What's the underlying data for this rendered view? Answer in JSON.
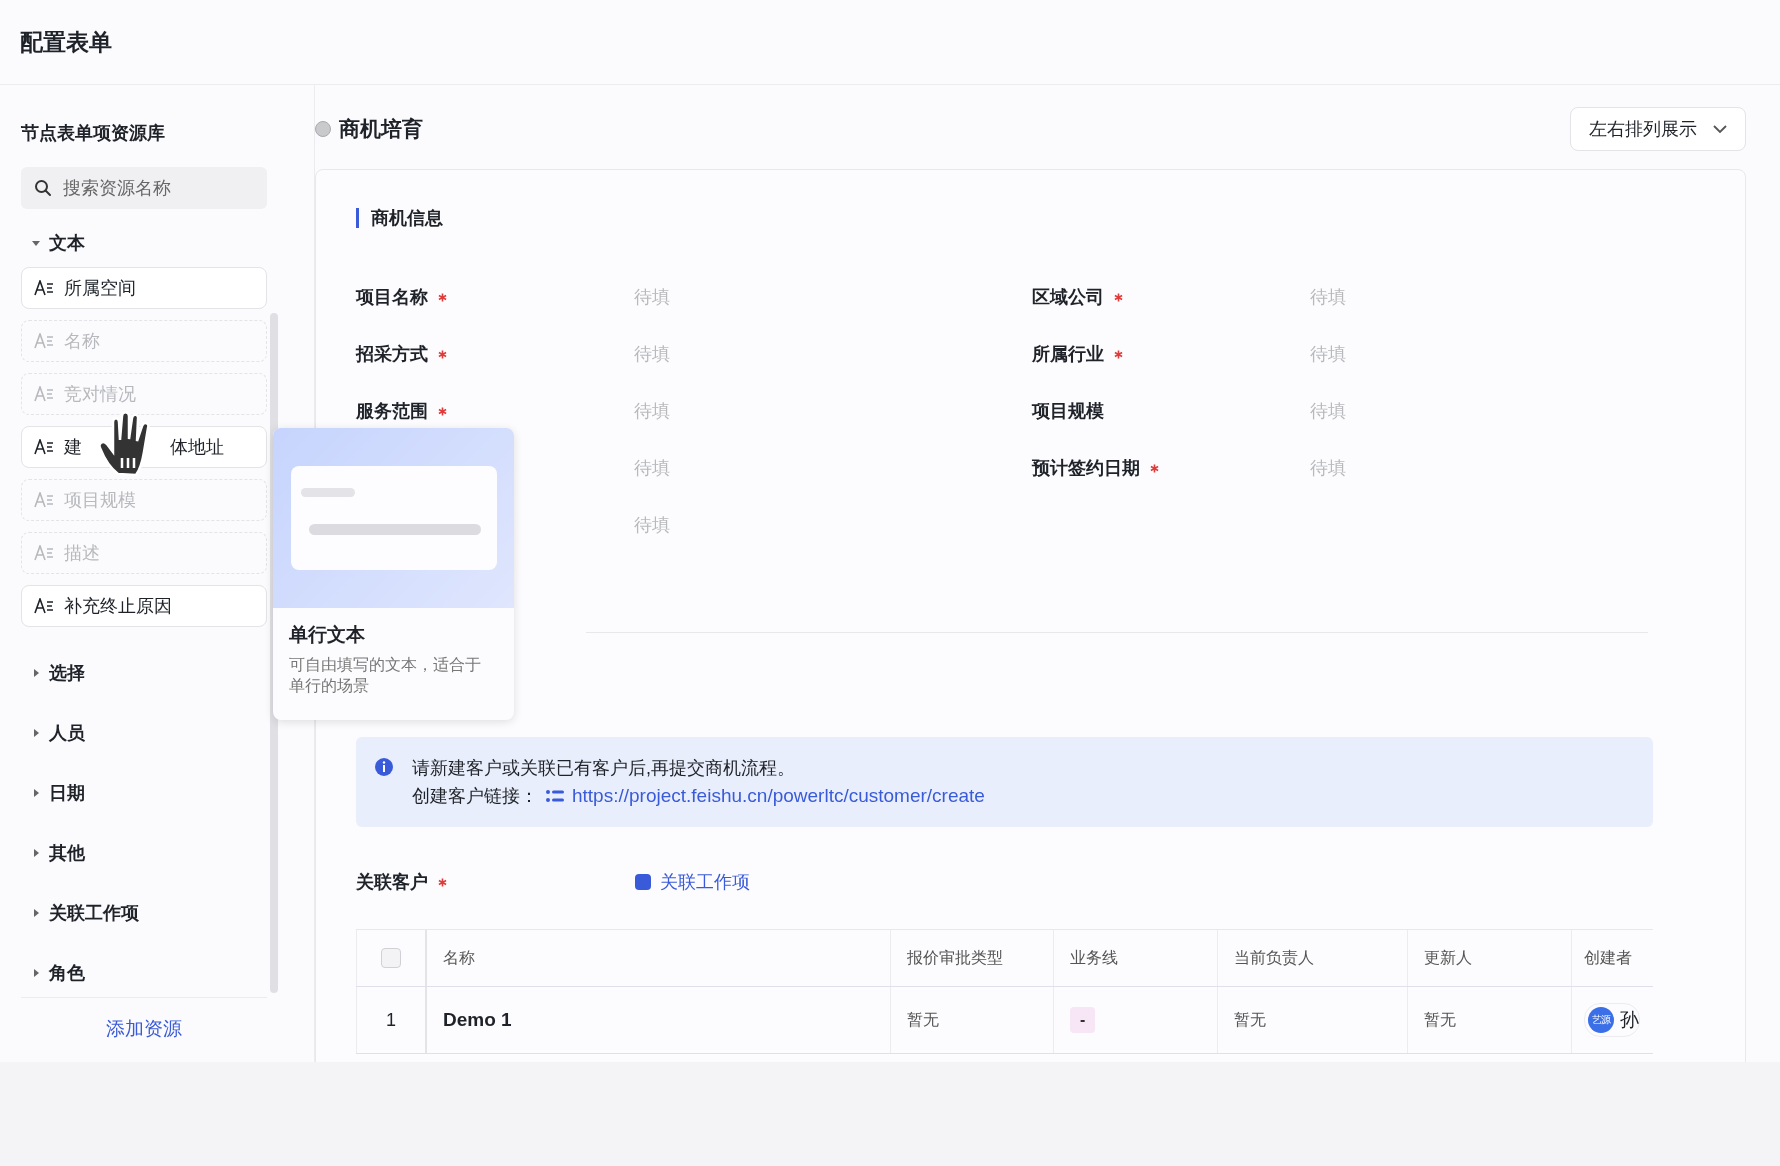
{
  "page_title": "配置表单",
  "sidebar": {
    "title": "节点表单项资源库",
    "search": {
      "placeholder": "搜索资源名称"
    },
    "groups": [
      {
        "label": "文本",
        "expanded": true,
        "items": [
          {
            "label_parts": [
              "所属空间"
            ],
            "disabled": false
          },
          {
            "label_parts": [
              "名称"
            ],
            "disabled": true
          },
          {
            "label_parts": [
              "竞对情况"
            ],
            "disabled": true
          },
          {
            "label_parts": [
              "建",
              "体地址"
            ],
            "disabled": false
          },
          {
            "label_parts": [
              "项目规模"
            ],
            "disabled": true
          },
          {
            "label_parts": [
              "描述"
            ],
            "disabled": true
          },
          {
            "label_parts": [
              "补充终止原因"
            ],
            "disabled": false
          }
        ]
      },
      {
        "label": "选择",
        "expanded": false
      },
      {
        "label": "人员",
        "expanded": false
      },
      {
        "label": "日期",
        "expanded": false
      },
      {
        "label": "其他",
        "expanded": false
      },
      {
        "label": "关联工作项",
        "expanded": false
      },
      {
        "label": "角色",
        "expanded": false
      }
    ],
    "add_button": "添加资源"
  },
  "tooltip": {
    "title": "单行文本",
    "description": "可自由填写的文本，适合于单行的场景"
  },
  "stage": {
    "title": "商机培育",
    "layout_select": "左右排列展示"
  },
  "section": {
    "title": "商机信息",
    "fields": [
      {
        "label": "项目名称",
        "required": true,
        "value": "待填"
      },
      {
        "label": "区域公司",
        "required": true,
        "value": "待填"
      },
      {
        "label": "招采方式",
        "required": true,
        "value": "待填"
      },
      {
        "label": "所属行业",
        "required": true,
        "value": "待填"
      },
      {
        "label": "服务范围",
        "required": true,
        "value": "待填"
      },
      {
        "label": "项目规模",
        "required": false,
        "value": "待填"
      },
      {
        "value": "待填"
      },
      {
        "label": "预计签约日期",
        "required": true,
        "value": "待填"
      },
      {
        "value": "待填"
      }
    ]
  },
  "notice": {
    "message": "请新建客户或关联已有客户后,再提交商机流程。",
    "link_label": "创建客户链接：",
    "link": "https://project.feishu.cn/powerltc/customer/create"
  },
  "relation": {
    "label": "关联客户",
    "required": true,
    "link": "关联工作项"
  },
  "table": {
    "header_checkbox": {
      "checked": false
    },
    "columns": [
      "名称",
      "报价审批类型",
      "业务线",
      "当前负责人",
      "更新人",
      "创建者"
    ],
    "rows": [
      {
        "index": "1",
        "cells": [
          "Demo 1",
          "暂无",
          "-",
          "暂无",
          "暂无"
        ],
        "creator": {
          "avatar": "艺源",
          "name": "孙"
        }
      }
    ]
  }
}
